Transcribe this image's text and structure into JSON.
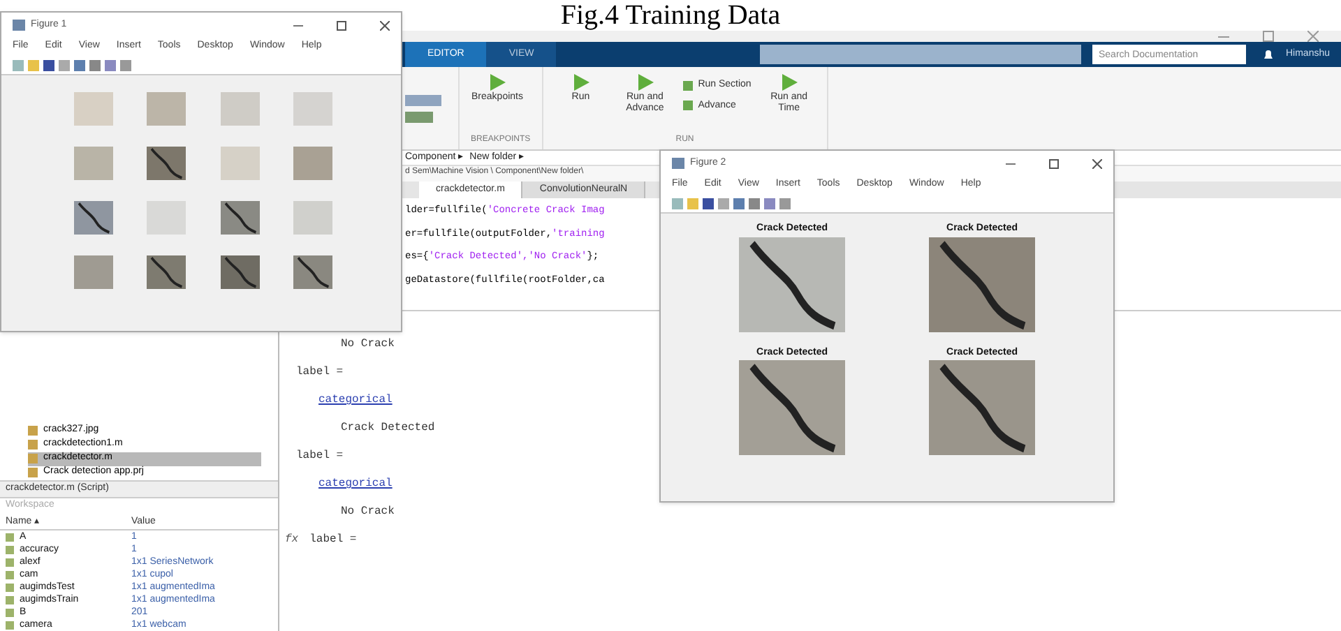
{
  "caption": "Fig.4 Training Data",
  "matlab": {
    "tabs": [
      {
        "label": "EDITOR",
        "selected": true
      },
      {
        "label": "VIEW",
        "selected": false
      }
    ],
    "search": {
      "placeholder": "Search Documentation"
    },
    "user": "Himanshu",
    "toolstrip": [
      {
        "label": "BREAKPOINTS",
        "buttons": [
          {
            "kind": "big",
            "label": "Breakpoints"
          }
        ]
      },
      {
        "label": "RUN",
        "buttons": [
          {
            "kind": "big",
            "label": "Run"
          },
          {
            "kind": "big",
            "label": "Run and Advance"
          },
          {
            "kind": "small",
            "label": "Run Section"
          },
          {
            "kind": "small",
            "label": "Advance"
          },
          {
            "kind": "big",
            "label": "Run and Time"
          }
        ]
      }
    ],
    "breadcrumb": [
      "Component ▸",
      "New folder ▸"
    ],
    "path": "d Sem\\Machine Vision \\ Component\\New folder\\",
    "editor_tabs": [
      {
        "label": "crackdetector.m",
        "selected": true
      },
      {
        "label": "ConvolutionNeuralN",
        "selected": false
      }
    ],
    "code_lines": [
      {
        "code": "lder=fullfile(",
        "string": "'Concrete Crack Imag"
      },
      {
        "code": "er=fullfile(outputFolder,",
        "string": "'training"
      },
      {
        "code": "es={",
        "string": "'Crack Detected','No Crack'",
        "tail": "};"
      },
      {
        "code": "geDatastore(fullfile(rootFolder,ca"
      }
    ],
    "command_window": [
      {
        "kind": "value",
        "text": "No Crack"
      },
      {
        "kind": "var",
        "text": "label ="
      },
      {
        "kind": "type",
        "text": "categorical"
      },
      {
        "kind": "value",
        "text": "Crack Detected"
      },
      {
        "kind": "var",
        "text": "label ="
      },
      {
        "kind": "type",
        "text": "categorical"
      },
      {
        "kind": "value",
        "text": "No Crack"
      },
      {
        "kind": "prompt",
        "icon": "fx",
        "text": "label ="
      }
    ],
    "current_folder": {
      "files": [
        {
          "name": "crack327.jpg",
          "selected": false
        },
        {
          "name": "crackdetection1.m",
          "selected": false
        },
        {
          "name": "crackdetector.m",
          "selected": true
        },
        {
          "name": "Crack detection app.prj",
          "selected": false
        }
      ],
      "details": "crackdetector.m (Script)"
    },
    "workspace": {
      "title": "Workspace",
      "columns": [
        "Name ▴",
        "Value"
      ],
      "rows": [
        {
          "name": "A",
          "value": "1"
        },
        {
          "name": "accuracy",
          "value": "1"
        },
        {
          "name": "alexf",
          "value": "1x1 SeriesNetwork"
        },
        {
          "name": "cam",
          "value": "1x1 cupol"
        },
        {
          "name": "augimdsTest",
          "value": "1x1 augmentedIma"
        },
        {
          "name": "augimdsTrain",
          "value": "1x1 augmentedIma"
        },
        {
          "name": "B",
          "value": "201"
        },
        {
          "name": "camera",
          "value": "1x1 webcam"
        }
      ]
    }
  },
  "figure_1": {
    "title": "Figure 1",
    "menu": [
      "File",
      "Edit",
      "View",
      "Insert",
      "Tools",
      "Desktop",
      "Window",
      "Help"
    ],
    "images": [
      {
        "crack": false
      },
      {
        "crack": false
      },
      {
        "crack": false
      },
      {
        "crack": false
      },
      {
        "crack": false
      },
      {
        "crack": true
      },
      {
        "crack": false
      },
      {
        "crack": false
      },
      {
        "crack": true
      },
      {
        "crack": false
      },
      {
        "crack": true
      },
      {
        "crack": false
      },
      {
        "crack": false
      },
      {
        "crack": true
      },
      {
        "crack": true
      },
      {
        "crack": true
      }
    ]
  },
  "figure_2": {
    "title": "Figure 2",
    "menu": [
      "File",
      "Edit",
      "View",
      "Insert",
      "Tools",
      "Desktop",
      "Window",
      "Help"
    ],
    "panels": [
      {
        "title": "Crack Detected",
        "crack": true
      },
      {
        "title": "Crack Detected",
        "crack": true
      },
      {
        "title": "Crack Detected",
        "crack": true
      },
      {
        "title": "Crack Detected",
        "crack": true
      }
    ]
  }
}
